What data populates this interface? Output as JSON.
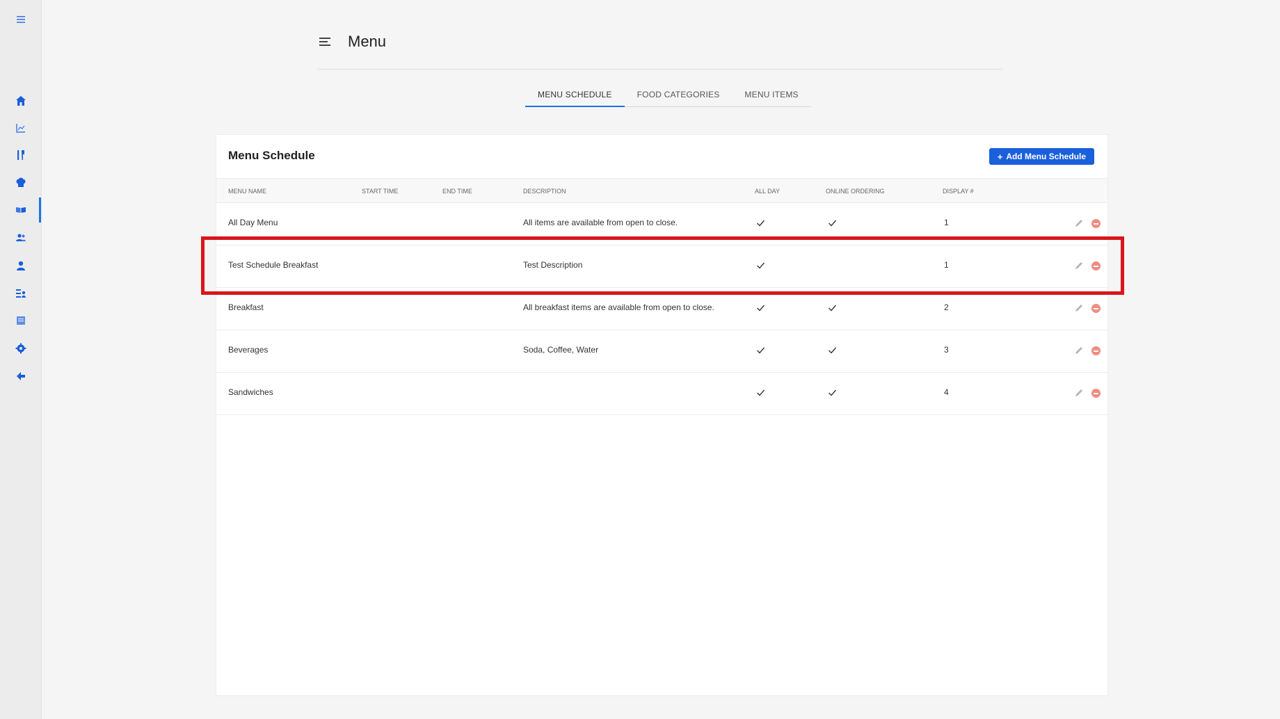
{
  "page": {
    "title": "Menu"
  },
  "sidebar": {
    "items": [
      {
        "name": "hamburger-icon"
      },
      {
        "name": "home-icon"
      },
      {
        "name": "chart-icon"
      },
      {
        "name": "utensils-icon"
      },
      {
        "name": "chef-hat-icon"
      },
      {
        "name": "menu-book-icon"
      },
      {
        "name": "users-icon"
      },
      {
        "name": "user-icon"
      },
      {
        "name": "user-list-icon"
      },
      {
        "name": "document-icon"
      },
      {
        "name": "gear-icon"
      },
      {
        "name": "back-arrow-icon"
      }
    ],
    "active_index": 5,
    "accent_color": "#1a73e8"
  },
  "tabs": [
    {
      "label": "MENU SCHEDULE",
      "active": true
    },
    {
      "label": "FOOD CATEGORIES",
      "active": false
    },
    {
      "label": "MENU ITEMS",
      "active": false
    }
  ],
  "card": {
    "title": "Menu Schedule",
    "add_button_label": "Add Menu Schedule",
    "add_button_color": "#1a5fdb"
  },
  "table": {
    "columns": [
      "MENU NAME",
      "START TIME",
      "END TIME",
      "DESCRIPTION",
      "ALL DAY",
      "ONLINE ORDERING",
      "DISPLAY #"
    ],
    "rows": [
      {
        "name": "All Day Menu",
        "start": "",
        "end": "",
        "description": "All items are available from open to close.",
        "all_day": true,
        "online_ordering": true,
        "display": "1"
      },
      {
        "name": "Test Schedule Breakfast",
        "start": "",
        "end": "",
        "description": "Test Description",
        "all_day": true,
        "online_ordering": false,
        "display": "1"
      },
      {
        "name": "Breakfast",
        "start": "",
        "end": "",
        "description": "All breakfast items are available from open to close.",
        "all_day": true,
        "online_ordering": true,
        "display": "2"
      },
      {
        "name": "Beverages",
        "start": "",
        "end": "",
        "description": "Soda, Coffee, Water",
        "all_day": true,
        "online_ordering": true,
        "display": "3"
      },
      {
        "name": "Sandwiches",
        "start": "",
        "end": "",
        "description": "",
        "all_day": true,
        "online_ordering": true,
        "display": "4"
      }
    ],
    "highlighted_row": 1,
    "highlight_color": "#d9161c",
    "delete_color": "#f28b82"
  }
}
